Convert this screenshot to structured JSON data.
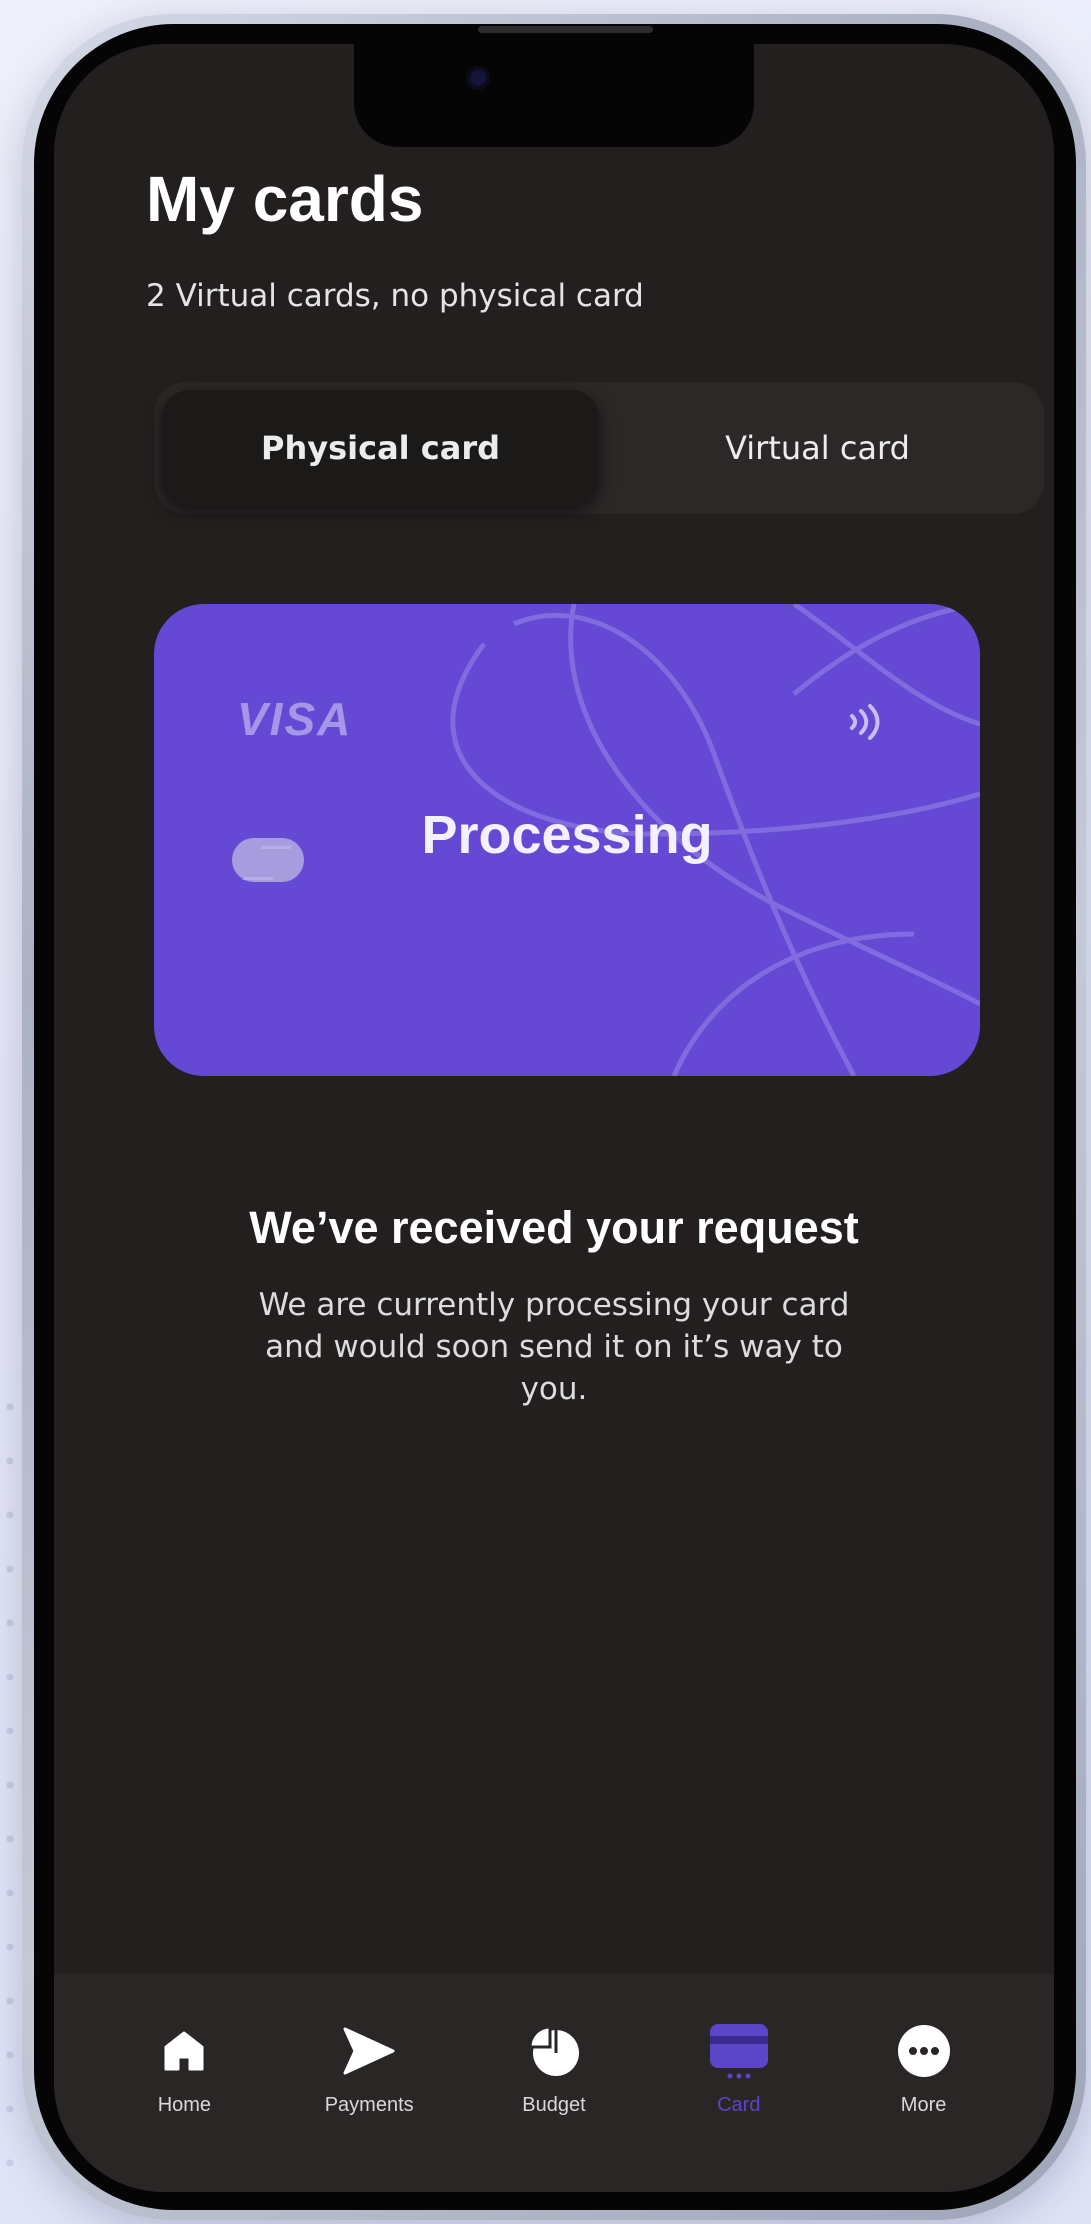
{
  "header": {
    "title": "My cards",
    "subtitle": "2 Virtual cards, no physical card"
  },
  "segmented": {
    "options": [
      {
        "label": "Physical card",
        "active": true
      },
      {
        "label": "Virtual card",
        "active": false
      }
    ]
  },
  "card": {
    "brand": "VISA",
    "status": "Processing",
    "color": "#6549d5"
  },
  "request": {
    "title": "We’ve received your request",
    "body": "We are currently processing your card and would soon send it on it’s way to you."
  },
  "tabbar": {
    "items": [
      {
        "label": "Home",
        "icon": "home-icon",
        "active": false
      },
      {
        "label": "Payments",
        "icon": "send-icon",
        "active": false
      },
      {
        "label": "Budget",
        "icon": "pie-chart-icon",
        "active": false
      },
      {
        "label": "Card",
        "icon": "card-icon",
        "active": true
      },
      {
        "label": "More",
        "icon": "more-icon",
        "active": false
      }
    ],
    "active_color": "#5b45c8"
  }
}
